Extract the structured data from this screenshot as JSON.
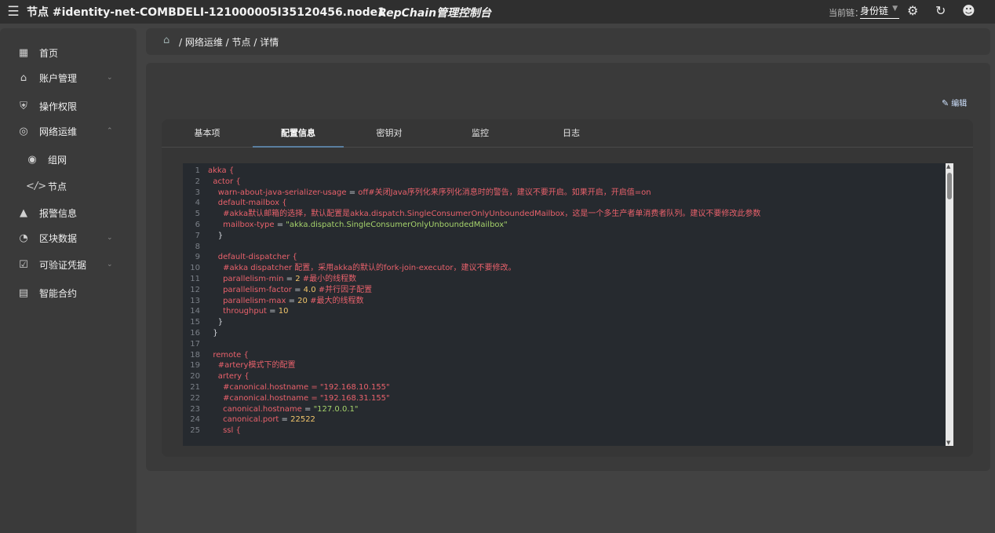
{
  "topbar": {
    "menu_icon": "hamburger-icon",
    "title": "节点 #identity-net-COMBDELI-121000005I35120456.node1",
    "brand": "RepChain管理控制台",
    "chain_label": "当前链：",
    "chain_value": "身份链",
    "icons": [
      "settings-icon",
      "refresh-icon",
      "account-icon"
    ]
  },
  "sidebar": {
    "items": [
      {
        "label": "首页",
        "icon": "dashboard-icon"
      },
      {
        "label": "账户管理",
        "icon": "bank-icon",
        "chevron": "down"
      },
      {
        "label": "操作权限",
        "icon": "shield-icon"
      },
      {
        "label": "网络运维",
        "icon": "network-icon",
        "chevron": "up"
      },
      {
        "label": "组网",
        "icon": "group-icon",
        "sub": true
      },
      {
        "label": "节点",
        "icon": "code-icon",
        "sub": true
      },
      {
        "label": "报警信息",
        "icon": "warning-icon"
      },
      {
        "label": "区块数据",
        "icon": "block-icon",
        "chevron": "down"
      },
      {
        "label": "可验证凭据",
        "icon": "credential-icon",
        "chevron": "down"
      },
      {
        "label": "智能合约",
        "icon": "contract-icon"
      }
    ]
  },
  "breadcrumb": {
    "text": "/ 网络运维 / 节点 / 详情"
  },
  "edit_label": "编辑",
  "tabs": [
    "基本项",
    "配置信息",
    "密钥对",
    "监控",
    "日志"
  ],
  "active_tab": 1,
  "colors": {
    "accent": "#5a7fa0",
    "key": "#e8616b",
    "string": "#a5d26b",
    "number": "#f2c56b",
    "plain": "#d7dae0"
  },
  "code_lines": [
    {
      "n": "1",
      "t": "akka {"
    },
    {
      "n": "2",
      "t": "  actor {"
    },
    {
      "n": "3",
      "t": "    warn-about-java-serializer-usage = off#关闭Java序列化来序列化消息时的警告，建议不要开启。如果开启，开启值=on"
    },
    {
      "n": "4",
      "t": "    default-mailbox {"
    },
    {
      "n": "5",
      "t": "      #akka默认邮箱的选择，默认配置是akka.dispatch.SingleConsumerOnlyUnboundedMailbox，这是一个多生产者单消费者队列。建议不要修改此参数"
    },
    {
      "n": "6",
      "t": "      mailbox-type = \"akka.dispatch.SingleConsumerOnlyUnboundedMailbox\""
    },
    {
      "n": "7",
      "t": "    }"
    },
    {
      "n": "8",
      "t": ""
    },
    {
      "n": "9",
      "t": "    default-dispatcher {"
    },
    {
      "n": "10",
      "t": "      #akka dispatcher 配置，采用akka的默认的fork-join-executor，建议不要修改。"
    },
    {
      "n": "11",
      "t": "      parallelism-min = 2 #最小的线程数"
    },
    {
      "n": "12",
      "t": "      parallelism-factor = 4.0 #并行因子配置"
    },
    {
      "n": "13",
      "t": "      parallelism-max = 20 #最大的线程数"
    },
    {
      "n": "14",
      "t": "      throughput = 10"
    },
    {
      "n": "15",
      "t": "    }"
    },
    {
      "n": "16",
      "t": "  }"
    },
    {
      "n": "17",
      "t": ""
    },
    {
      "n": "18",
      "t": "  remote {"
    },
    {
      "n": "19",
      "t": "    #artery模式下的配置"
    },
    {
      "n": "20",
      "t": "    artery {"
    },
    {
      "n": "21",
      "t": "      #canonical.hostname = \"192.168.10.155\""
    },
    {
      "n": "22",
      "t": "      #canonical.hostname = \"192.168.31.155\""
    },
    {
      "n": "23",
      "t": "      canonical.hostname = \"127.0.0.1\""
    },
    {
      "n": "24",
      "t": "      canonical.port = 22522"
    },
    {
      "n": "25",
      "t": "      ssl {"
    }
  ]
}
